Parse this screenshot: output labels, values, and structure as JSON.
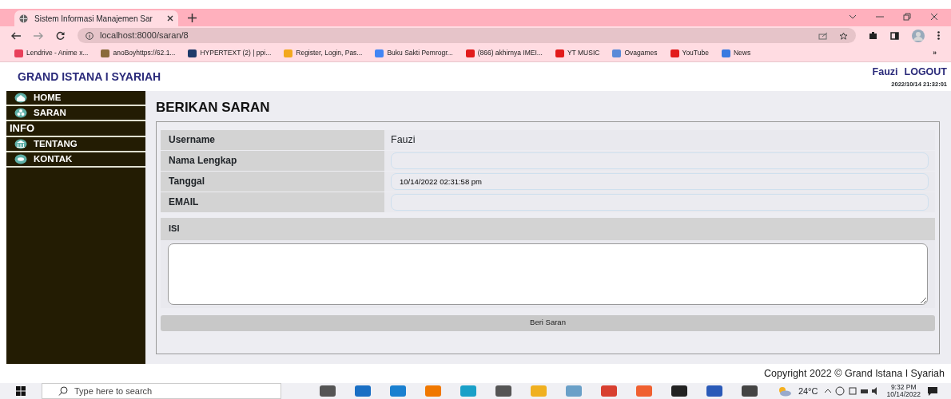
{
  "browser": {
    "tab": {
      "title": "Sistem Informasi Manajemen Sar",
      "selected": true
    },
    "url": "localhost:8000/saran/8",
    "bookmarks": [
      {
        "label": "Lendrive - Anime x...",
        "color": "#e8405a"
      },
      {
        "label": "anoBoyhttps://62.1...",
        "color": "#8a6a3a"
      },
      {
        "label": "HYPERTEXT (2) | ppi...",
        "color": "#1f3a6a"
      },
      {
        "label": "Register, Login, Pas...",
        "color": "#f2a81d"
      },
      {
        "label": "Buku Sakti Pemrogr...",
        "color": "#4285f4"
      },
      {
        "label": "(866) akhirnya IMEI...",
        "color": "#e21b1b"
      },
      {
        "label": "YT MUSIC",
        "color": "#e21b1b"
      },
      {
        "label": "Ovagames",
        "color": "#5a8ad8"
      },
      {
        "label": "YouTube",
        "color": "#e21b1b"
      },
      {
        "label": "News",
        "color": "#3a7ae0"
      }
    ],
    "overflow": "»"
  },
  "header": {
    "brand": "GRAND ISTANA I SYARIAH",
    "user": "Fauzi",
    "logout": "LOGOUT",
    "datetime": "2022/10/14 21:32:01"
  },
  "sidebar": [
    {
      "kind": "link",
      "label": "HOME"
    },
    {
      "kind": "link",
      "label": "SARAN"
    },
    {
      "kind": "heading",
      "label": "INFO"
    },
    {
      "kind": "link",
      "label": "TENTANG"
    },
    {
      "kind": "link",
      "label": "KONTAK"
    }
  ],
  "form": {
    "title": "BERIKAN SARAN",
    "fields": [
      {
        "label": "Username",
        "kind": "text",
        "value": "Fauzi"
      },
      {
        "label": "Nama Lengkap",
        "kind": "input"
      },
      {
        "label": "Tanggal",
        "kind": "input",
        "value": "10/14/2022 02:31:58 pm"
      },
      {
        "label": "EMAIL",
        "kind": "input"
      }
    ],
    "message_label": "ISI",
    "submit": "Beri Saran"
  },
  "footer": "Copyright 2022 © Grand Istana I Syariah",
  "taskbar": {
    "search": {
      "placeholder": "Type here to search"
    },
    "weather": "24°C",
    "time": "9:32 PM",
    "date": "10/14/2022"
  }
}
